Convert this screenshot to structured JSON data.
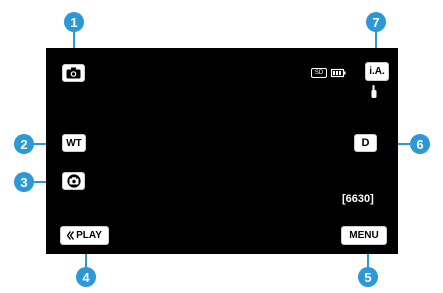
{
  "callouts": [
    "1",
    "2",
    "3",
    "4",
    "5",
    "6",
    "7"
  ],
  "screen": {
    "wt_label": "WT",
    "d_label": "D",
    "ia_label": "i.A.",
    "sd_label": "SD",
    "shots_remaining": "[6630]",
    "play_label": "PLAY",
    "menu_label": "MENU"
  },
  "icons": {
    "mode": "camera-icon",
    "snapshot": "camera-circle-icon",
    "battery": "battery-icon",
    "back": "double-chevron-left-icon",
    "stabilizer": "hand-icon"
  },
  "colors": {
    "callout": "#2c98d6",
    "screen_bg": "#000000",
    "button_bg": "#ffffff"
  }
}
